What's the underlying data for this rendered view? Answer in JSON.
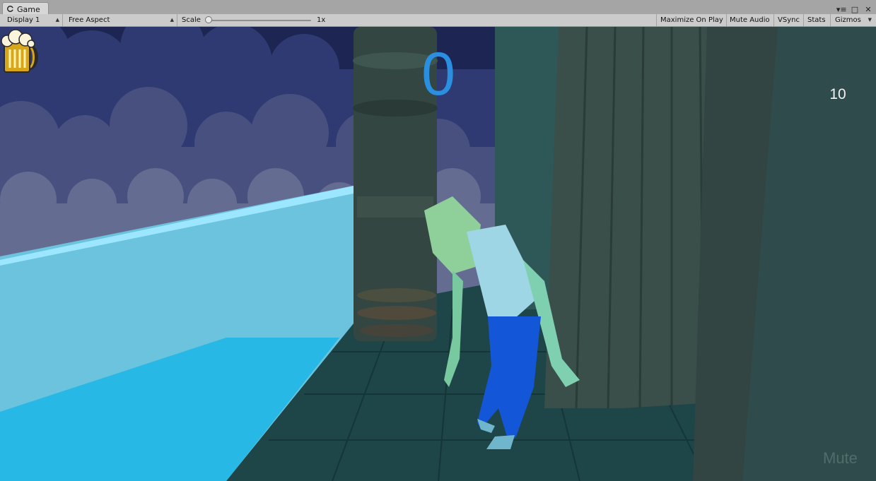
{
  "window": {
    "tab_label": "Game",
    "controls": [
      "▾≡",
      "□",
      "✕"
    ]
  },
  "toolbar": {
    "display": "Display 1",
    "aspect": "Free Aspect",
    "scale_label": "Scale",
    "scale_value": "1x",
    "maximize": "Maximize On Play",
    "mute_audio": "Mute Audio",
    "vsync": "VSync",
    "stats": "Stats",
    "gizmos": "Gizmos"
  },
  "game": {
    "score": "0",
    "beer_count": "10",
    "mute_label": "Mute",
    "icons": [
      "unity-icon",
      "beer-mug-icon"
    ],
    "colors": {
      "score": "#2a8fe0",
      "sky": "#1c2552",
      "water": "#4fc6e8",
      "floor": "#1f4a4c",
      "pants": "#1254d6"
    }
  }
}
